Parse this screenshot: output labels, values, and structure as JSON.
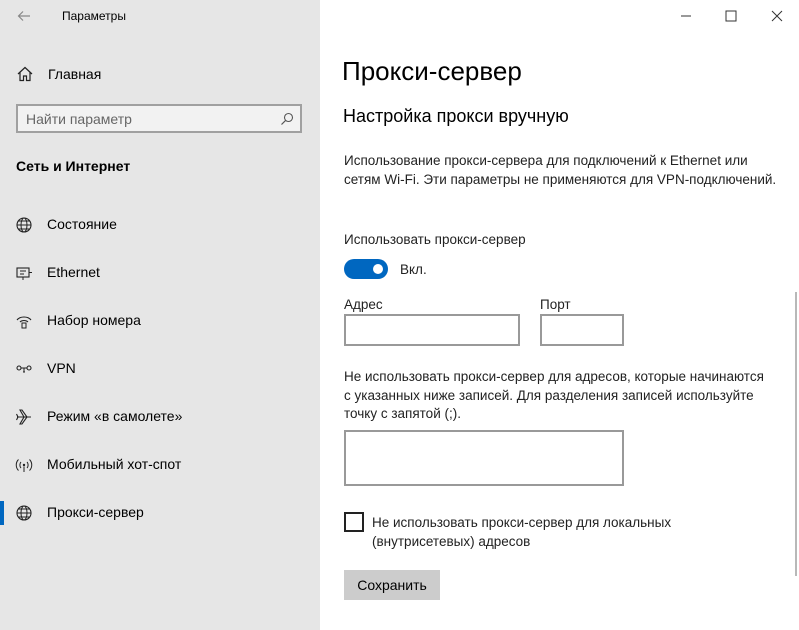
{
  "window": {
    "title": "Параметры"
  },
  "sidebar": {
    "home_label": "Главная",
    "search_placeholder": "Найти параметр",
    "section_title": "Сеть и Интернет",
    "items": [
      {
        "label": "Состояние",
        "icon": "globe-icon"
      },
      {
        "label": "Ethernet",
        "icon": "ethernet-icon"
      },
      {
        "label": "Набор номера",
        "icon": "dialup-icon"
      },
      {
        "label": "VPN",
        "icon": "vpn-icon"
      },
      {
        "label": "Режим «в самолете»",
        "icon": "airplane-icon"
      },
      {
        "label": "Мобильный хот-спот",
        "icon": "hotspot-icon"
      },
      {
        "label": "Прокси-сервер",
        "icon": "proxy-globe-icon",
        "selected": true
      }
    ]
  },
  "main": {
    "page_title": "Прокси-сервер",
    "section_title": "Настройка прокси вручную",
    "description": "Использование прокси-сервера для подключений к Ethernet или сетям Wi-Fi. Эти параметры не применяются для VPN-подключений.",
    "use_proxy_label": "Использовать прокси-сервер",
    "toggle": {
      "state": "Вкл.",
      "on": true
    },
    "address_label": "Адрес",
    "address_value": "",
    "port_label": "Порт",
    "port_value": "",
    "exceptions_description": "Не использовать прокси-сервер для адресов, которые начинаются с указанных ниже записей. Для разделения записей используйте точку с запятой (;).",
    "exceptions_value": "",
    "local_checkbox_label": "Не использовать прокси-сервер для локальных (внутрисетевых) адресов",
    "local_checkbox_checked": false,
    "save_label": "Сохранить"
  },
  "colors": {
    "accent": "#0067c0",
    "sidebar_bg": "#e6e6e6",
    "button_bg": "#cccccc"
  }
}
